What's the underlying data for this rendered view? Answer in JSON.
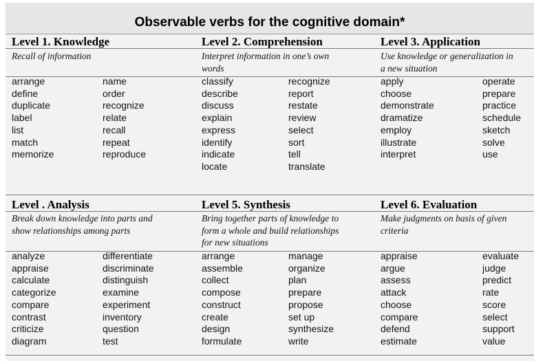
{
  "title": "Observable verbs for the cognitive domain*",
  "levels": [
    {
      "title": "Level 1. Knowledge",
      "description": [
        "Recall of information"
      ],
      "verbs_col1": [
        "arrange",
        "define",
        "duplicate",
        "label",
        "list",
        "match",
        "memorize"
      ],
      "verbs_col2": [
        "name",
        "order",
        "recognize",
        "relate",
        "recall",
        "repeat",
        "reproduce"
      ]
    },
    {
      "title": "Level 2. Comprehension",
      "description": [
        "Interpret information in one’s own",
        "words"
      ],
      "verbs_col1": [
        "classify",
        "describe",
        "discuss",
        "explain",
        "express",
        "identify",
        "indicate",
        "locate"
      ],
      "verbs_col2": [
        "recognize",
        "report",
        "restate",
        "review",
        "select",
        "sort",
        "tell",
        "translate"
      ]
    },
    {
      "title": "Level 3. Application",
      "description": [
        "Use knowledge or generalization in",
        "a new situation"
      ],
      "verbs_col1": [
        "apply",
        "choose",
        "demonstrate",
        "dramatize",
        "employ",
        "illustrate",
        "interpret"
      ],
      "verbs_col2": [
        "operate",
        "prepare",
        "practice",
        "schedule",
        "sketch",
        "solve",
        "use"
      ]
    },
    {
      "title": "Level . Analysis",
      "description": [
        "Break down knowledge into parts and",
        "show relationships among parts"
      ],
      "verbs_col1": [
        "analyze",
        "appraise",
        "calculate",
        "categorize",
        "compare",
        "contrast",
        "criticize",
        "diagram"
      ],
      "verbs_col2": [
        "differentiate",
        "discriminate",
        "distinguish",
        "examine",
        "experiment",
        "inventory",
        "question",
        "test"
      ]
    },
    {
      "title": "Level 5. Synthesis",
      "description": [
        "Bring together parts of knowledge to",
        "form a whole and build relationships",
        "for new situations"
      ],
      "verbs_col1": [
        "arrange",
        "assemble",
        "collect",
        "compose",
        "construct",
        "create",
        "design",
        "formulate"
      ],
      "verbs_col2": [
        "manage",
        "organize",
        "plan",
        "prepare",
        "propose",
        "set up",
        "synthesize",
        "write"
      ]
    },
    {
      "title": "Level 6. Evaluation",
      "description": [
        "Make judgments on basis of given",
        "criteria"
      ],
      "verbs_col1": [
        "appraise",
        "argue",
        "assess",
        "attack",
        "choose",
        "compare",
        "defend",
        "estimate"
      ],
      "verbs_col2": [
        "evaluate",
        "judge",
        "predict",
        "rate",
        "score",
        "select",
        "support",
        "value"
      ]
    }
  ]
}
